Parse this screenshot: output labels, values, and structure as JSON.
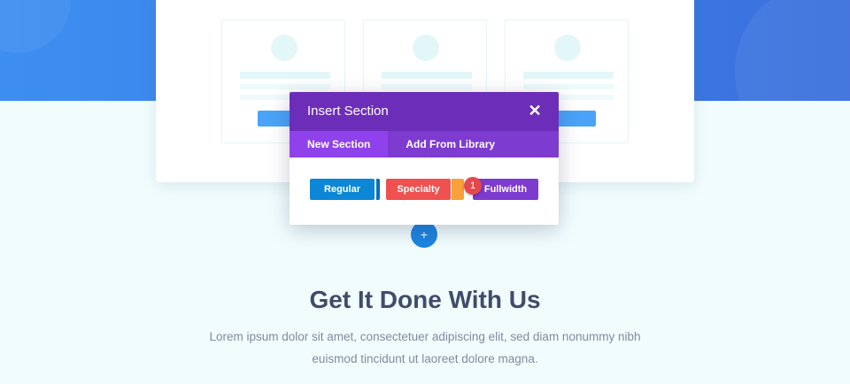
{
  "modal": {
    "title": "Insert Section",
    "close_icon": "close-icon",
    "tabs": [
      {
        "label": "New Section",
        "active": true
      },
      {
        "label": "Add From Library",
        "active": false
      }
    ],
    "section_types": [
      {
        "label": "Regular",
        "color": "#0c86d6",
        "accent_color": "#0a6fb3"
      },
      {
        "label": "Specialty",
        "color": "#ee5150",
        "accent_color": "#f7a13a"
      },
      {
        "label": "Fullwidth",
        "color": "#7e3bd0"
      }
    ],
    "step_badge": "1"
  },
  "add_section_icon": "plus-icon",
  "page": {
    "headline": "Get It Done With Us",
    "body_line1": "Lorem ipsum dolor sit amet, consectetuer adipiscing elit, sed diam nonummy nibh",
    "body_line2": "euismod tincidunt ut laoreet dolore magna."
  },
  "colors": {
    "hero_blue": "#3d8ef0",
    "modal_header": "#6c2eb9",
    "tab_bar": "#7e3bd0",
    "add_button": "#1d85e0"
  }
}
